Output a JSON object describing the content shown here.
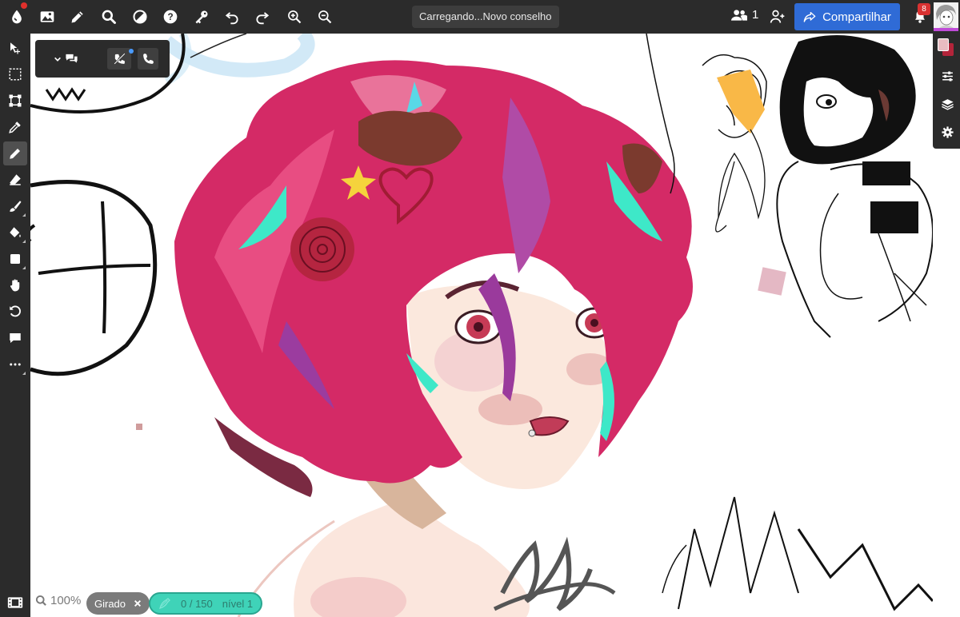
{
  "topbar": {
    "status_text": "Carregando...Novo conselho",
    "users_online": "1",
    "share_label": "Compartilhar",
    "notifications_count": "8",
    "icons": [
      "app-logo-icon",
      "gallery-icon",
      "pencil-icon",
      "search-icon",
      "contrast-icon",
      "help-icon",
      "key-icon",
      "undo-icon",
      "redo-icon",
      "zoom-in-icon",
      "zoom-out-icon",
      "users-icon",
      "add-user-icon",
      "share-icon",
      "bell-icon"
    ]
  },
  "left_tools": [
    "move-icon",
    "select-icon",
    "transform-icon",
    "eyedropper-icon",
    "pencil-icon",
    "eraser-icon",
    "brush-icon",
    "fill-icon",
    "rectangle-icon",
    "hand-icon",
    "rotate-icon",
    "comment-icon",
    "more-icon"
  ],
  "right_panel": [
    "color-swatch",
    "adjustments-icon",
    "layers-icon",
    "settings-icon"
  ],
  "bottom": {
    "zoom": "100%",
    "rotation_label": "Girado",
    "layer_count": "0 / 150",
    "layer_level": "nível 1"
  },
  "colors": {
    "accent": "#2f6bd6",
    "bar_bg": "#2b2b2b",
    "primary_color": "#e8bcc1",
    "secondary_color": "#b3243a",
    "layer_pill": "#3fd3b8"
  }
}
